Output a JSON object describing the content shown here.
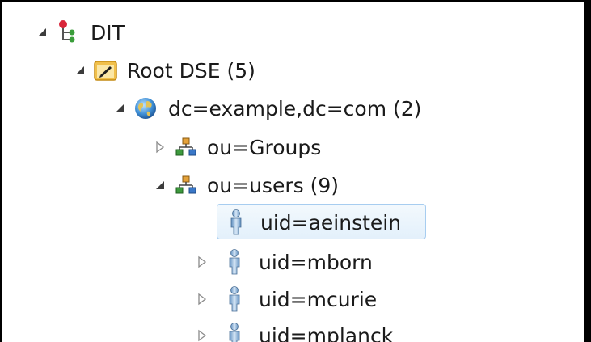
{
  "tree": {
    "nodes": [
      {
        "label": "DIT",
        "icon": "dit-tree-icon",
        "expanded": true,
        "level": 0
      },
      {
        "label": "Root DSE (5)",
        "icon": "root-dse-folder-icon",
        "expanded": true,
        "level": 1
      },
      {
        "label": "dc=example,dc=com (2)",
        "icon": "globe-icon",
        "expanded": true,
        "level": 2
      },
      {
        "label": "ou=Groups",
        "icon": "org-unit-icon",
        "expanded": false,
        "level": 3
      },
      {
        "label": "ou=users (9)",
        "icon": "org-unit-icon",
        "expanded": true,
        "level": 3
      },
      {
        "label": "uid=aeinstein",
        "icon": "person-icon",
        "expanded": null,
        "level": 4,
        "selected": true
      },
      {
        "label": "uid=mborn",
        "icon": "person-icon",
        "expanded": false,
        "level": 4
      },
      {
        "label": "uid=mcurie",
        "icon": "person-icon",
        "expanded": false,
        "level": 4
      },
      {
        "label": "uid=mplanck",
        "icon": "person-icon",
        "expanded": false,
        "level": 4
      }
    ]
  },
  "colors": {
    "selection_bg": "#e3f0fb",
    "selection_border": "#a7cdf0",
    "text": "#1a1a1a"
  }
}
